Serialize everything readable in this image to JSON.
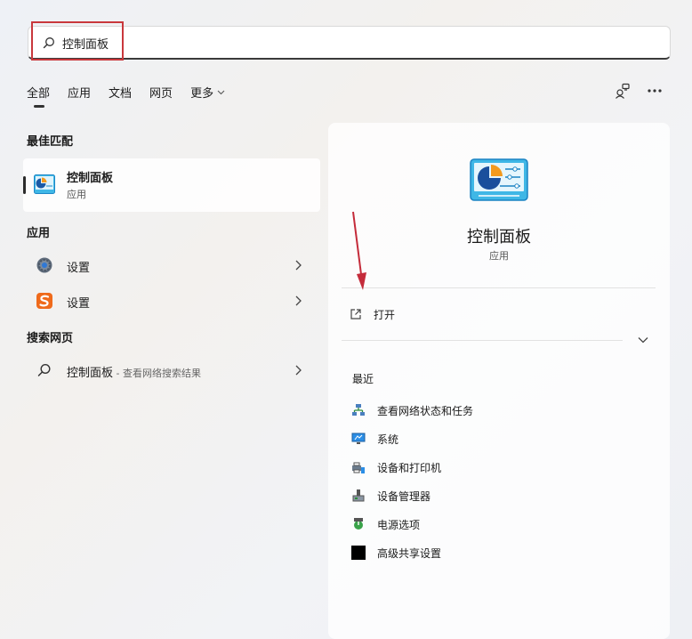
{
  "search": {
    "value": "控制面板"
  },
  "tabs": [
    {
      "label": "全部",
      "active": true
    },
    {
      "label": "应用"
    },
    {
      "label": "文档"
    },
    {
      "label": "网页"
    },
    {
      "label": "更多"
    }
  ],
  "sections": {
    "best_match": "最佳匹配",
    "apps": "应用",
    "web": "搜索网页"
  },
  "best_match": {
    "name": "控制面板",
    "type": "应用"
  },
  "apps": [
    {
      "label": "设置",
      "icon": "gear-icon"
    },
    {
      "label": "设置",
      "icon": "sogou-s-icon"
    }
  ],
  "web": {
    "label": "控制面板",
    "hint": " - 查看网络搜索结果"
  },
  "detail": {
    "title": "控制面板",
    "type": "应用",
    "open_label": "打开",
    "recent_title": "最近",
    "recent": [
      {
        "label": "查看网络状态和任务",
        "icon": "network-icon"
      },
      {
        "label": "系统",
        "icon": "monitor-icon"
      },
      {
        "label": "设备和打印机",
        "icon": "printer-icon"
      },
      {
        "label": "设备管理器",
        "icon": "device-manager-icon"
      },
      {
        "label": "电源选项",
        "icon": "power-icon"
      },
      {
        "label": "高级共享设置",
        "icon": "black-square-icon"
      }
    ]
  },
  "colors": {
    "highlight_box": "#c9383c",
    "annotation_arrow": "#c42b3a",
    "accent_blue": "#2b8ee6"
  }
}
